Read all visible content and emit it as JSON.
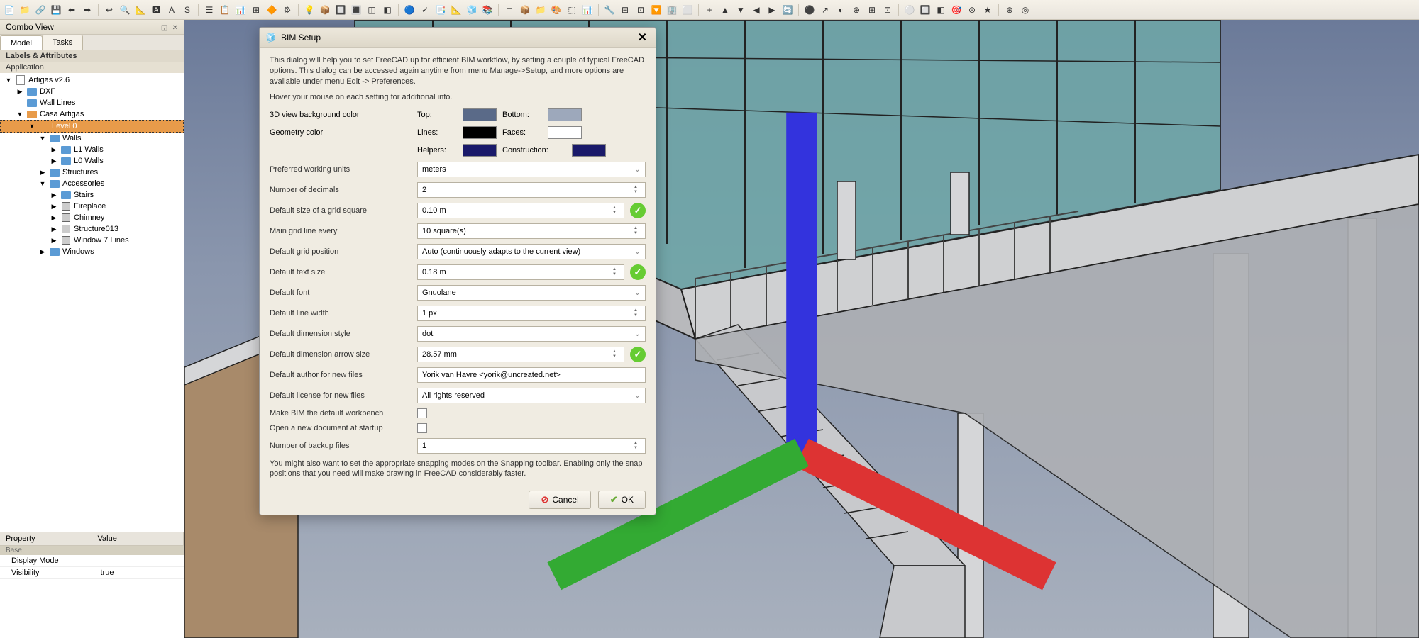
{
  "toolbar_icons": [
    "📄",
    "📁",
    "🔗",
    "💾",
    "⬅",
    "➡",
    "↩",
    "🔍",
    "📐",
    "🅰",
    "A",
    "S",
    "☰",
    "📋",
    "📊",
    "⊞",
    "🔶",
    "⚙",
    "💡",
    "📦",
    "🔲",
    "🔳",
    "◫",
    "◧",
    "🔵",
    "✓",
    "📑",
    "📐",
    "🧊",
    "📚",
    "◻",
    "📦",
    "📁",
    "🎨",
    "⬚",
    "📊",
    "🔧",
    "⊟",
    "⊡",
    "🔽",
    "🏢",
    "⬜",
    "+",
    "▲",
    "▼",
    "◀",
    "▶",
    "🔄",
    "⚫",
    "↗",
    "◐",
    "⊕",
    "⊞",
    "⊡",
    "⚪",
    "🔲",
    "◧",
    "🎯",
    "⊙",
    "★",
    "⊕",
    "◎"
  ],
  "combo_view": {
    "title": "Combo View",
    "tabs": [
      "Model",
      "Tasks"
    ],
    "labels_section": "Labels & Attributes",
    "app_section": "Application"
  },
  "tree": [
    {
      "depth": 0,
      "exp": "▼",
      "icon": "doc",
      "label": "Artigas v2.6"
    },
    {
      "depth": 1,
      "exp": "▶",
      "icon": "fb",
      "label": "DXF"
    },
    {
      "depth": 1,
      "exp": "",
      "icon": "fb",
      "label": "Wall Lines"
    },
    {
      "depth": 1,
      "exp": "▼",
      "icon": "fo",
      "label": "Casa Artigas"
    },
    {
      "depth": 2,
      "exp": "▼",
      "icon": "fo",
      "label": "Level 0",
      "selected": true
    },
    {
      "depth": 3,
      "exp": "▼",
      "icon": "fb",
      "label": "Walls"
    },
    {
      "depth": 4,
      "exp": "▶",
      "icon": "fb",
      "label": "L1 Walls"
    },
    {
      "depth": 4,
      "exp": "▶",
      "icon": "fb",
      "label": "L0 Walls"
    },
    {
      "depth": 3,
      "exp": "▶",
      "icon": "fb",
      "label": "Structures"
    },
    {
      "depth": 3,
      "exp": "▼",
      "icon": "fb",
      "label": "Accessories"
    },
    {
      "depth": 4,
      "exp": "▶",
      "icon": "fb",
      "label": "Stairs"
    },
    {
      "depth": 4,
      "exp": "▶",
      "icon": "pt",
      "label": "Fireplace"
    },
    {
      "depth": 4,
      "exp": "▶",
      "icon": "pt",
      "label": "Chimney"
    },
    {
      "depth": 4,
      "exp": "▶",
      "icon": "pt",
      "label": "Structure013"
    },
    {
      "depth": 4,
      "exp": "▶",
      "icon": "pt",
      "label": "Window 7 Lines"
    },
    {
      "depth": 3,
      "exp": "▶",
      "icon": "fb",
      "label": "Windows"
    }
  ],
  "properties": {
    "header": [
      "Property",
      "Value"
    ],
    "group": "Base",
    "rows": [
      {
        "name": "Display Mode",
        "value": ""
      },
      {
        "name": "Visibility",
        "value": "true"
      }
    ]
  },
  "dialog": {
    "title": "BIM Setup",
    "description": "This dialog will help you to set FreeCAD up for efficient BIM workflow, by setting a couple of typical FreeCAD options. This dialog can be accessed again anytime from menu Manage->Setup, and more options are available under menu Edit -> Preferences.",
    "hint": "Hover your mouse on each setting for additional info.",
    "colors": {
      "bg_label": "3D view background color",
      "top_label": "Top:",
      "top": "#5a6a88",
      "bottom_label": "Bottom:",
      "bottom": "#9da8bb",
      "geom_label": "Geometry color",
      "lines_label": "Lines:",
      "lines": "#000000",
      "faces_label": "Faces:",
      "faces": "#ffffff",
      "helpers_label": "Helpers:",
      "helpers": "#1a1a6a",
      "construction_label": "Construction:",
      "construction": "#1a1a6a"
    },
    "fields": {
      "units_label": "Preferred working units",
      "units": "meters",
      "decimals_label": "Number of decimals",
      "decimals": "2",
      "gridsize_label": "Default size of a grid square",
      "gridsize": "0.10 m",
      "gridline_label": "Main grid line every",
      "gridline": "10 square(s)",
      "gridpos_label": "Default grid position",
      "gridpos": "Auto (continuously adapts to the current view)",
      "textsize_label": "Default text size",
      "textsize": "0.18 m",
      "font_label": "Default font",
      "font": "Gnuolane",
      "linewidth_label": "Default line width",
      "linewidth": "1 px",
      "dimstyle_label": "Default dimension style",
      "dimstyle": "dot",
      "arrowsize_label": "Default dimension arrow size",
      "arrowsize": "28.57 mm",
      "author_label": "Default author for new files",
      "author": "Yorik van Havre <yorik@uncreated.net>",
      "license_label": "Default license for new files",
      "license": "All rights reserved",
      "makedef_label": "Make BIM the default workbench",
      "opennew_label": "Open a new document at startup",
      "backup_label": "Number of backup files",
      "backup": "1"
    },
    "note": "You might also want to set the appropriate snapping modes on the Snapping toolbar. Enabling only the snap positions that you need will make drawing in FreeCAD considerably faster.",
    "buttons": {
      "cancel": "Cancel",
      "ok": "OK"
    }
  }
}
